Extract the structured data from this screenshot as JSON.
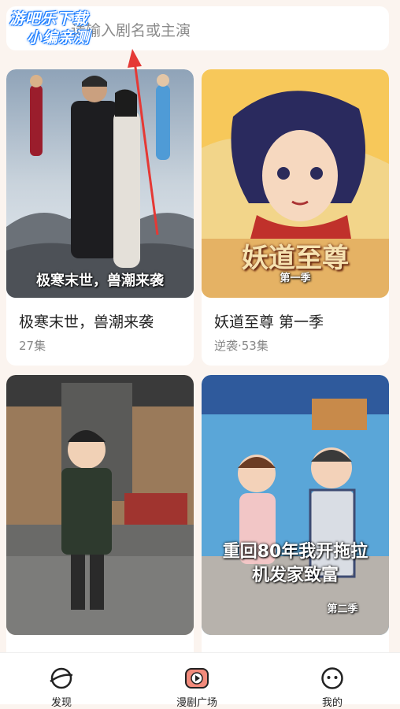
{
  "search": {
    "placeholder": "请输入剧名或主演"
  },
  "watermark": {
    "line1": "游吧乐下载",
    "line2": "小编亲测"
  },
  "cards": [
    {
      "title": "极寒末世，兽潮来袭",
      "meta": "27集",
      "poster_text": "极寒末世，兽潮来袭"
    },
    {
      "title": "妖道至尊 第一季",
      "meta": "逆袭·53集",
      "poster_text": "妖道至尊",
      "poster_sub": "第一季"
    },
    {
      "title": "",
      "meta": "",
      "poster_text": ""
    },
    {
      "title": "",
      "meta": "",
      "poster_text": "重回80年我开拖拉机发家致富",
      "poster_sub": "第二季"
    }
  ],
  "tabbar": {
    "items": [
      {
        "label": "发现",
        "icon": "planet-icon"
      },
      {
        "label": "漫剧广场",
        "icon": "tv-play-icon"
      },
      {
        "label": "我的",
        "icon": "face-icon"
      }
    ]
  },
  "colors": {
    "accent": "#e8412c",
    "background": "#fbf4ef"
  }
}
